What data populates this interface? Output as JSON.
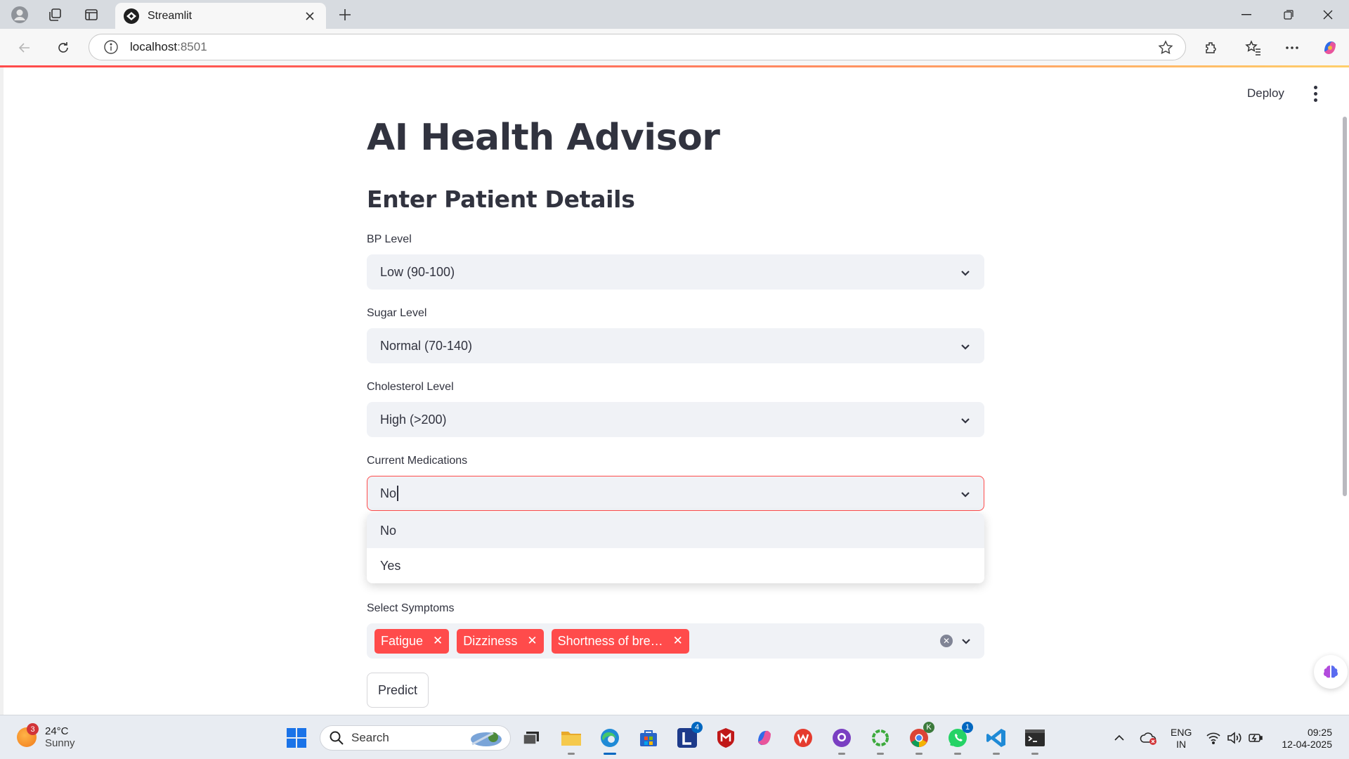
{
  "browser": {
    "tab_title": "Streamlit",
    "url_host": "localhost",
    "url_port": ":8501"
  },
  "app": {
    "deploy_label": "Deploy",
    "title": "AI Health Advisor",
    "subtitle": "Enter Patient Details",
    "fields": {
      "bp": {
        "label": "BP Level",
        "value": "Low (90-100)"
      },
      "sugar": {
        "label": "Sugar Level",
        "value": "Normal (70-140)"
      },
      "cholesterol": {
        "label": "Cholesterol Level",
        "value": "High (>200)"
      },
      "medications": {
        "label": "Current Medications",
        "value": "No",
        "options": [
          "No",
          "Yes"
        ],
        "highlighted": "No"
      }
    },
    "symptoms": {
      "label": "Select Symptoms",
      "chips": [
        "Fatigue",
        "Dizziness",
        "Shortness of bre…"
      ]
    },
    "predict_label": "Predict",
    "accent_color": "#ff4b4b"
  },
  "taskbar": {
    "weather": {
      "temp": "24°C",
      "condition": "Sunny",
      "badge": "3"
    },
    "search_placeholder": "Search",
    "badges": {
      "l_app": "4",
      "chrome": "K",
      "whatsapp": "1"
    },
    "lang_line1": "ENG",
    "lang_line2": "IN",
    "time": "09:25",
    "date": "12-04-2025"
  }
}
